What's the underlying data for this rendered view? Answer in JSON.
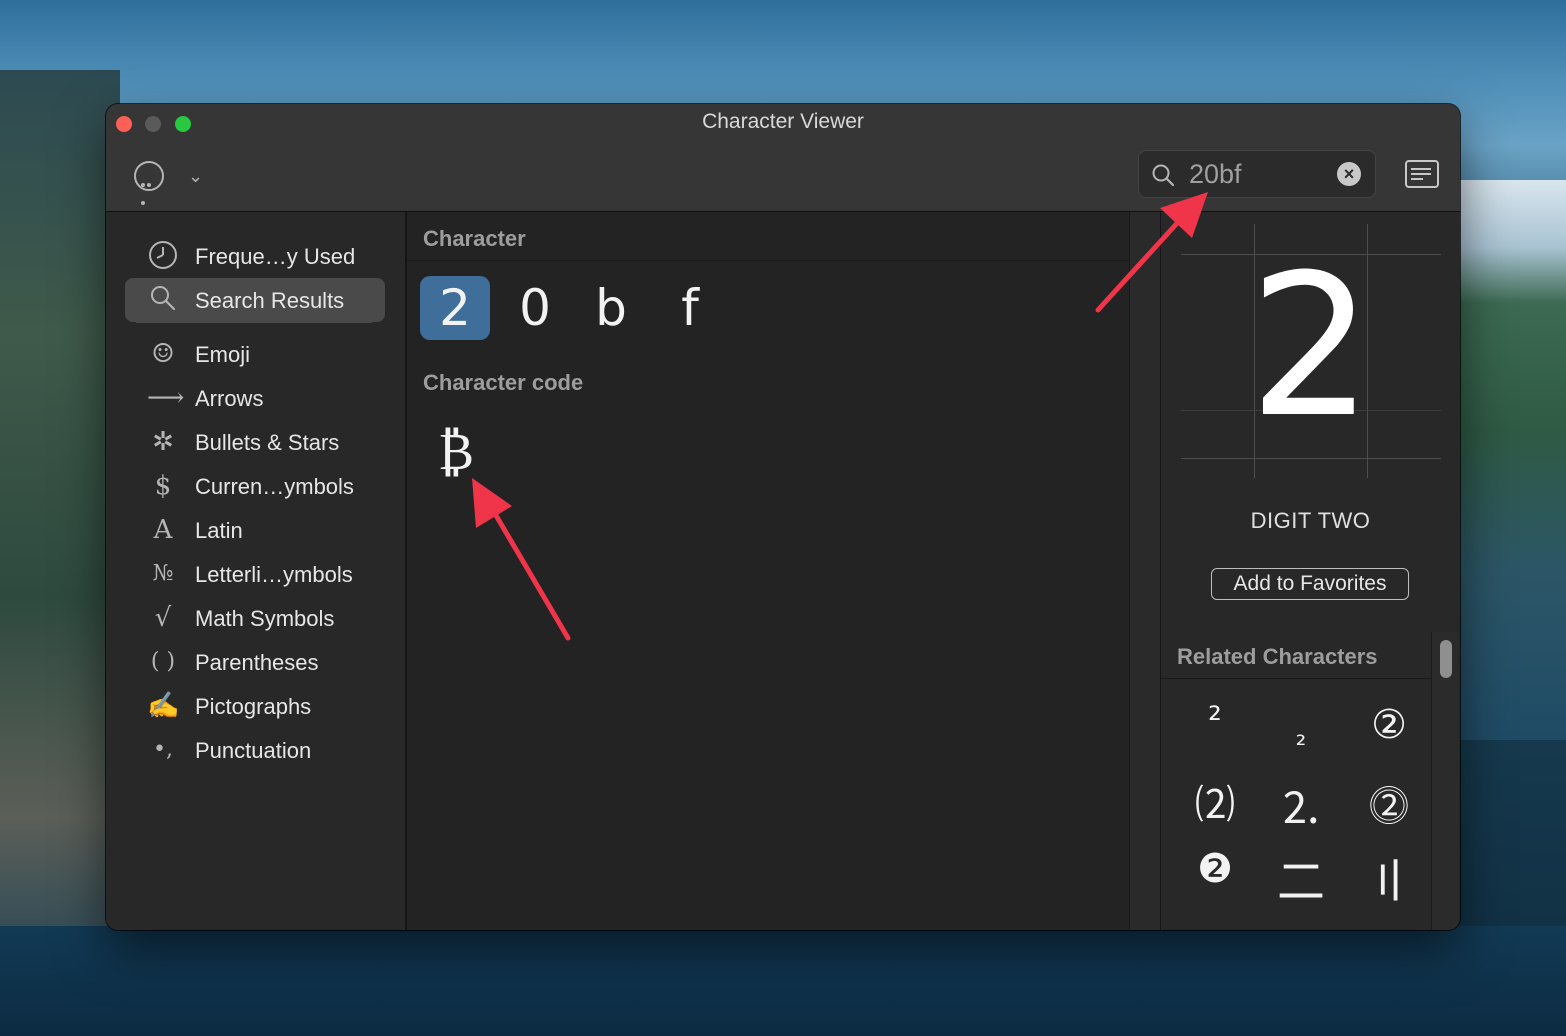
{
  "window": {
    "title": "Character Viewer"
  },
  "search": {
    "query": "20bf",
    "clear_symbol": "×"
  },
  "toolbar": {
    "chevron": "⌄"
  },
  "sidebar": {
    "items": [
      {
        "label": "Freque…y Used",
        "icon": "clock-icon",
        "glyph": "🕘"
      },
      {
        "label": "Search Results",
        "icon": "search-icon",
        "glyph": "⌕",
        "selected": true
      },
      {
        "label": "Emoji",
        "icon": "smiley-icon",
        "glyph": "☺"
      },
      {
        "label": "Arrows",
        "icon": "arrow-right-icon",
        "glyph": "⟶"
      },
      {
        "label": "Bullets & Stars",
        "icon": "asterisk-icon",
        "glyph": "✲"
      },
      {
        "label": "Curren…ymbols",
        "icon": "dollar-icon",
        "glyph": "$"
      },
      {
        "label": "Latin",
        "icon": "latin-a-icon",
        "glyph": "A"
      },
      {
        "label": "Letterli…ymbols",
        "icon": "numero-icon",
        "glyph": "№"
      },
      {
        "label": "Math Symbols",
        "icon": "square-root-icon",
        "glyph": "√"
      },
      {
        "label": "Parentheses",
        "icon": "parentheses-icon",
        "glyph": "( )"
      },
      {
        "label": "Pictographs",
        "icon": "writing-hand-icon",
        "glyph": "✍"
      },
      {
        "label": "Punctuation",
        "icon": "punctuation-icon",
        "glyph": "•,"
      }
    ]
  },
  "main": {
    "character_header": "Character",
    "characters": [
      "2",
      "0",
      "b",
      "f"
    ],
    "code_header": "Character code",
    "code_result": "₿"
  },
  "inspector": {
    "glyph": "2",
    "name": "DIGIT TWO",
    "favorites_label": "Add to Favorites",
    "related_header": "Related Characters",
    "related": [
      "²",
      "₂",
      "②",
      "⑵",
      "⒉",
      "⓶",
      "❷",
      "二",
      "〢"
    ]
  }
}
